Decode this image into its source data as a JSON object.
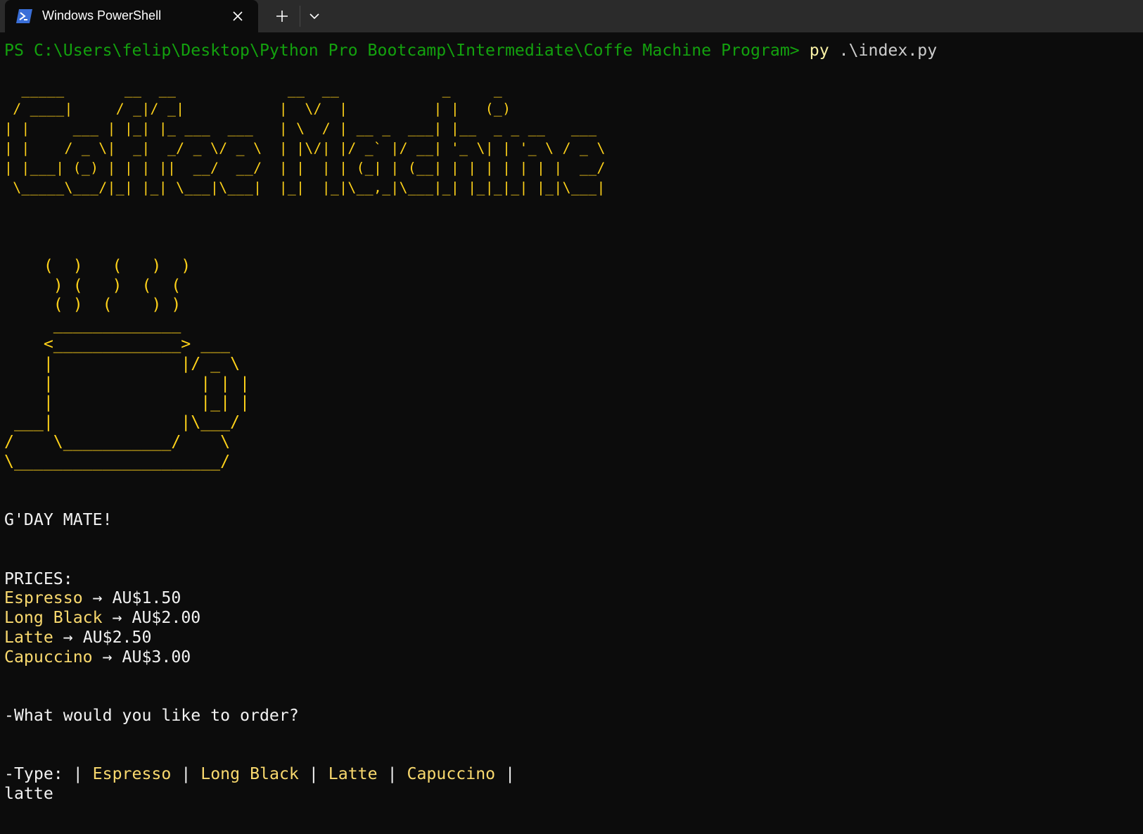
{
  "window": {
    "tab_title": "Windows PowerShell",
    "tab_icon": "powershell-icon",
    "close_icon": "close-icon",
    "new_tab_icon": "plus-icon",
    "dropdown_icon": "chevron-down-icon"
  },
  "terminal": {
    "prompt": "PS C:\\Users\\felip\\Desktop\\Python Pro Bootcamp\\Intermediate\\Coffe Machine Program>",
    "command": "py",
    "argument": ".\\index.py",
    "title_art": [
      "  _____       __  __             __  __            _     _             ",
      " / ____|     / _|/ _|           |  \\/  |          | |   (_)            ",
      "| |     ___ | |_| |_ ___  ___   | \\  / | __ _  ___| |__  _ _ __   ___ ",
      "| |    / _ \\|  _|  _/ _ \\/ _ \\  | |\\/| |/ _` |/ __| '_ \\| | '_ \\ / _ \\",
      "| |___| (_) | | | ||  __/  __/  | |  | | (_| | (__| | | | | | | |  __/",
      " \\_____\\___/|_| |_| \\___|\\___|  |_|  |_|\\__,_|\\___|_| |_|_|_| |_|\\___|"
    ],
    "cup_art": [
      "    (  )   (   )  )",
      "     ) (   )  (  (",
      "     ( )  (    ) )",
      "     _____________",
      "    <_____________> ___",
      "    |             |/ _ \\",
      "    |               | | |",
      "    |               |_| |",
      " ___|             |\\___/",
      "/    \\___________/    \\",
      "\\_____________________/"
    ],
    "greeting": "G'DAY MATE!",
    "prices_header": "PRICES:",
    "arrow": "→",
    "prices": [
      {
        "name": "Espresso",
        "price": "AU$1.50"
      },
      {
        "name": "Long Black",
        "price": "AU$2.00"
      },
      {
        "name": "Latte",
        "price": "AU$2.50"
      },
      {
        "name": "Capuccino",
        "price": "AU$3.00"
      }
    ],
    "question": "-What would you like to order?",
    "type_prefix": "-Type: ",
    "separator": "|",
    "options": [
      "Espresso",
      "Long Black",
      "Latte",
      "Capuccino"
    ],
    "user_input": "latte"
  },
  "colors": {
    "background": "#0c0c0c",
    "titlebar": "#2b2b2b",
    "prompt_green": "#13a10e",
    "command_yellow": "#f9f1a5",
    "art_yellow": "#ffd21a",
    "item_yellow": "#f9d96e",
    "text": "#cccccc"
  }
}
